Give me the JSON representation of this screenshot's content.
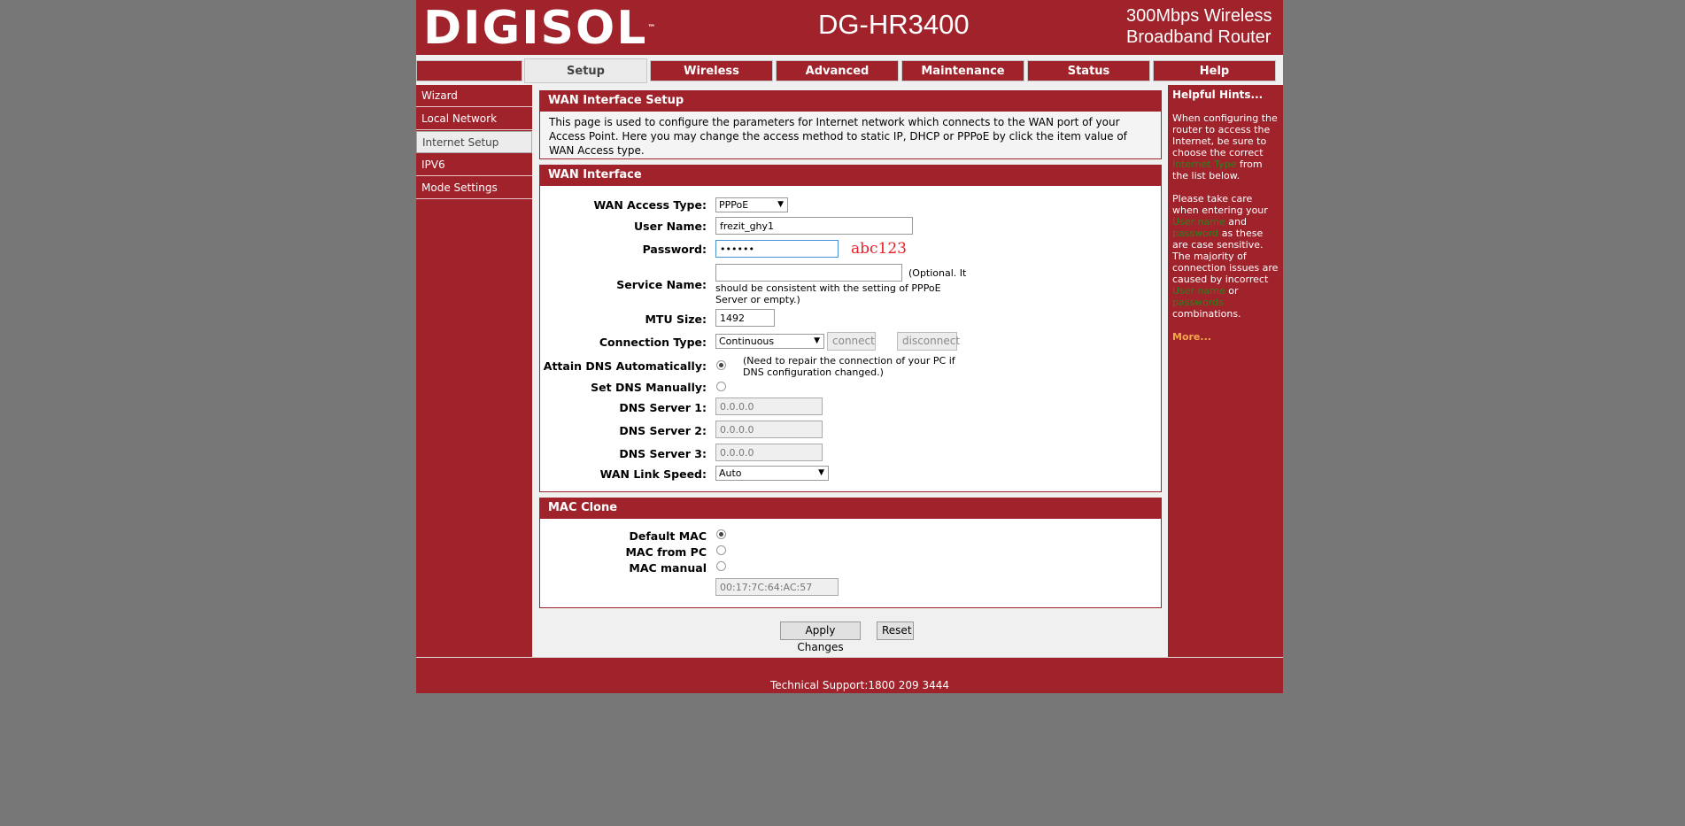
{
  "header": {
    "logo": "DIGISOL",
    "trademark": "™",
    "model": "DG-HR3400",
    "tagline_line1": "300Mbps Wireless",
    "tagline_line2": "Broadband Router"
  },
  "tabs": [
    "Setup",
    "Wireless",
    "Advanced",
    "Maintenance",
    "Status",
    "Help"
  ],
  "active_tab": "Setup",
  "sidebar": {
    "items": [
      "Wizard",
      "Local Network",
      "Internet Setup",
      "IPV6",
      "Mode Settings"
    ],
    "active": "Internet Setup"
  },
  "intro": {
    "title": "WAN Interface Setup",
    "text": "This page is used to configure the parameters for Internet network which connects to the WAN port of your Access Point. Here you may change the access method to static IP, DHCP or PPPoE by click the item value of WAN Access type."
  },
  "wan": {
    "title": "WAN Interface",
    "access_type_label": "WAN Access Type:",
    "access_type_value": "PPPoE",
    "username_label": "User Name:",
    "username_value": "frezit_ghy1",
    "password_label": "Password:",
    "password_value": "••••••",
    "password_annotation": "abc123",
    "service_label": "Service Name:",
    "service_value": "",
    "service_note_a": "(Optional. It",
    "service_note_b": "should be consistent with the setting of PPPoE Server or empty.)",
    "mtu_label": "MTU Size:",
    "mtu_value": "1492",
    "conn_type_label": "Connection Type:",
    "conn_type_value": "Continuous",
    "connect_label": "connect",
    "disconnect_label": "disconnect",
    "attain_dns_label": "Attain DNS Automatically:",
    "attain_dns_note": "(Need to repair the connection of your PC if DNS configuration changed.)",
    "set_dns_label": "Set DNS Manually:",
    "dns1_label": "DNS Server 1:",
    "dns1_value": "0.0.0.0",
    "dns2_label": "DNS Server 2:",
    "dns2_value": "0.0.0.0",
    "dns3_label": "DNS Server 3:",
    "dns3_value": "0.0.0.0",
    "link_speed_label": "WAN Link Speed:",
    "link_speed_value": "Auto"
  },
  "mac": {
    "title": "MAC Clone",
    "default_label": "Default MAC",
    "frompc_label": "MAC from PC",
    "manual_label": "MAC manual",
    "mac_value": "00:17:7C:64:AC:57"
  },
  "actions": {
    "apply": "Apply Changes",
    "reset": "Reset"
  },
  "hints": {
    "title": "Helpful Hints...",
    "p1_a": "When configuring the router to access the Internet, be sure to choose the correct",
    "p1_b": "Internet Type",
    "p1_c": "from the list below.",
    "p2_a": "Please take care when entering your",
    "p2_b": "User name",
    "p2_c": "and",
    "p2_d": "password",
    "p2_e": "as these are case sensitive. The majority of connection issues are caused by incorrect",
    "p2_f": "User name",
    "p2_g": "or",
    "p2_h": "passwords",
    "p2_i": "combinations.",
    "more": "More..."
  },
  "footer": {
    "support": "Technical Support:1800 209 3444"
  },
  "colors": {
    "brand_red": "#a0232c",
    "background": "#777777"
  }
}
